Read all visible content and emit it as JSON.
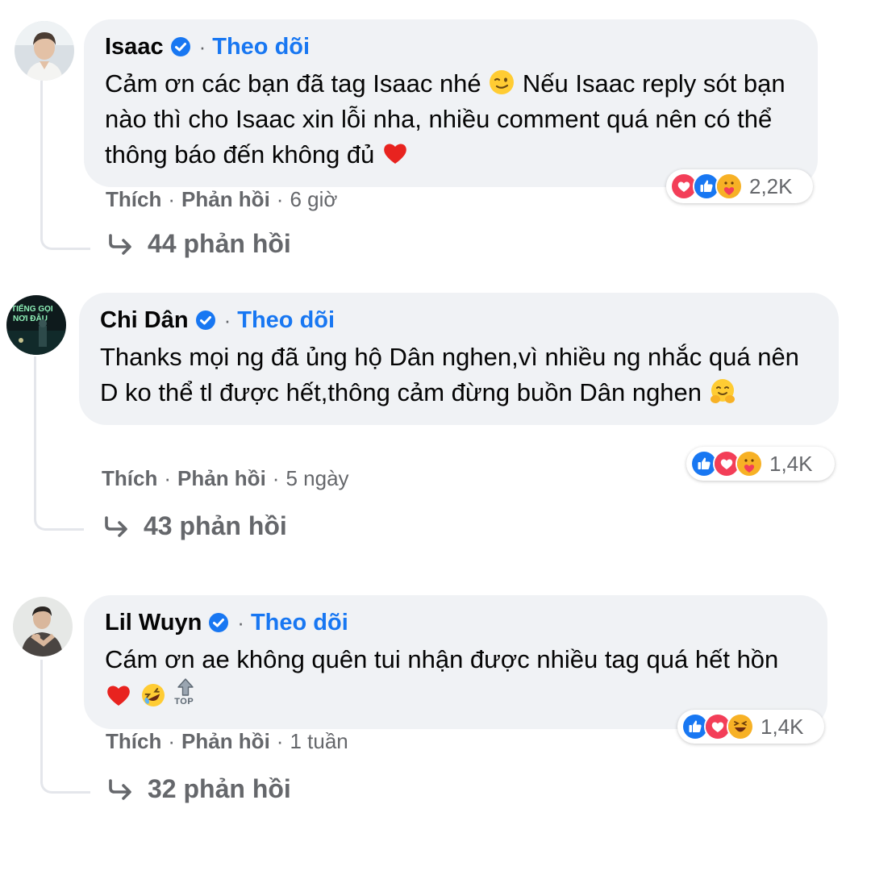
{
  "colors": {
    "follow": "#1877f2",
    "bubble": "#f0f2f5",
    "meta": "#65676b",
    "like": "#1877f2",
    "love": "#f33e58"
  },
  "comments": [
    {
      "author": "Isaac",
      "separator": "·",
      "follow_label": "Theo dõi",
      "text": "Cảm ơn các bạn đã tag Isaac nhé",
      "text_2": "Nếu Isaac reply sót bạn nào thì cho Isaac xin lỗi nha, nhiều comment quá nên có thể thông báo đến không đủ",
      "emojis": [
        "winking-face-emoji",
        "red-heart-emoji"
      ],
      "reactions": [
        "love",
        "like",
        "care"
      ],
      "reaction_count": "2,2K",
      "like_label": "Thích",
      "reply_label": "Phản hồi",
      "time": "6 giờ",
      "replies_label": "44 phản hồi"
    },
    {
      "author": "Chi Dân",
      "separator": "·",
      "follow_label": "Theo dõi",
      "text": "Thanks mọi ng đã ủng hộ Dân nghen,vì nhiều ng nhắc quá nên D ko thể tl được hết,thông cảm đừng buồn Dân nghen",
      "emojis": [
        "hugging-face-emoji"
      ],
      "reactions": [
        "like",
        "love",
        "care"
      ],
      "reaction_count": "1,4K",
      "like_label": "Thích",
      "reply_label": "Phản hồi",
      "time": "5 ngày",
      "replies_label": "43 phản hồi",
      "avatar_text": "TIẾNG GỌI NƠI ĐÂU"
    },
    {
      "author": "Lil Wuyn",
      "separator": "·",
      "follow_label": "Theo dõi",
      "text": "Cám ơn ae không quên tui nhận được nhiều tag quá hết hồn",
      "emojis": [
        "red-heart-emoji",
        "rolling-laughing-emoji",
        "top-arrow-emoji"
      ],
      "top_label": "TOP",
      "reactions": [
        "like",
        "love",
        "haha"
      ],
      "reaction_count": "1,4K",
      "like_label": "Thích",
      "reply_label": "Phản hồi",
      "time": "1 tuần",
      "replies_label": "32 phản hồi"
    }
  ]
}
